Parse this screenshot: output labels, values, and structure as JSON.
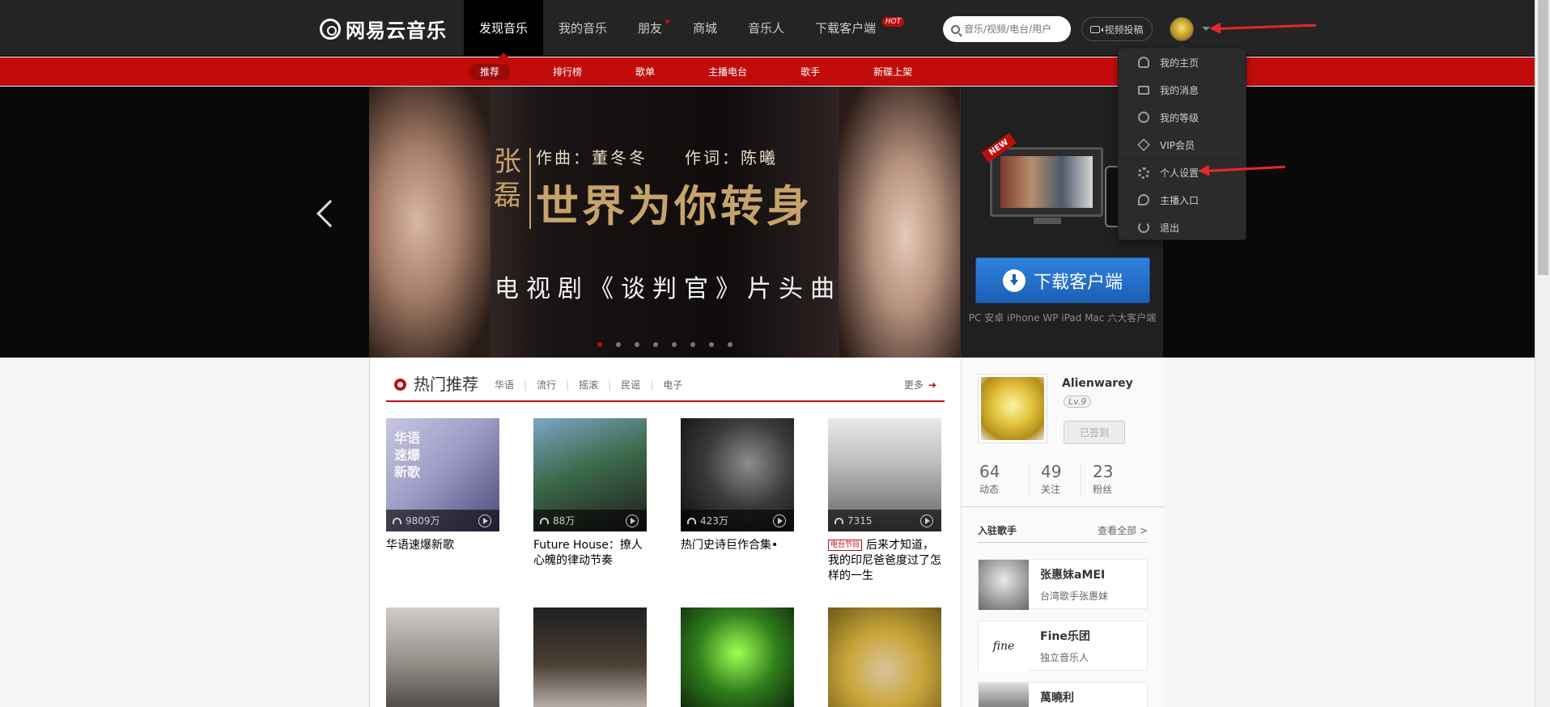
{
  "header": {
    "logo": "网易云音乐",
    "nav": [
      {
        "label": "发现音乐",
        "active": true
      },
      {
        "label": "我的音乐"
      },
      {
        "label": "朋友",
        "dot": true
      },
      {
        "label": "商城"
      },
      {
        "label": "音乐人"
      },
      {
        "label": "下载客户端",
        "badge": "HOT"
      }
    ],
    "search_placeholder": "音乐/视频/电台/用户",
    "upload_label": "视频投稿"
  },
  "subnav": [
    "推荐",
    "排行榜",
    "歌单",
    "主播电台",
    "歌手",
    "新碟上架"
  ],
  "banner": {
    "artist": "张磊",
    "credits": "作曲：董冬冬　　作词：陈曦",
    "song": "世界为你转身",
    "subtitle": "电视剧《谈判官》片头曲",
    "dots": 8,
    "active_dot": 0
  },
  "download": {
    "new_badge": "NEW",
    "button": "下载客户端",
    "note": "PC 安卓 iPhone WP iPad Mac 六大客户端"
  },
  "hot": {
    "title": "热门推荐",
    "tags": [
      "华语",
      "流行",
      "摇滚",
      "民谣",
      "电子"
    ],
    "more": "更多",
    "cards": [
      {
        "count": "9809万",
        "name": "华语速爆新歌",
        "cover_text": "华语\n速爆\n新歌"
      },
      {
        "count": "88万",
        "name": "Future House：撩人心魄的律动节奏"
      },
      {
        "count": "423万",
        "name": "热门史诗巨作合集•"
      },
      {
        "count": "7315",
        "name": "后来才知道，我的印尼爸爸度过了怎样的一生",
        "radio_tag": "电台节目"
      },
      {
        "count": "",
        "name": ""
      },
      {
        "count": "",
        "name": ""
      },
      {
        "count": "",
        "name": ""
      },
      {
        "count": "",
        "name": ""
      }
    ]
  },
  "profile": {
    "name": "Alienwarey",
    "level": "Lv.9",
    "signed": "已签到",
    "stats": [
      {
        "value": "64",
        "label": "动态"
      },
      {
        "value": "49",
        "label": "关注"
      },
      {
        "value": "23",
        "label": "粉丝"
      }
    ]
  },
  "artists": {
    "title": "入驻歌手",
    "view_all": "查看全部 >",
    "list": [
      {
        "name": "张惠妹aMEI",
        "desc": "台湾歌手张惠妹"
      },
      {
        "name": "Fine乐团",
        "desc": "独立音乐人",
        "logo_text": "fine"
      },
      {
        "name": "萬曉利",
        "desc": ""
      }
    ]
  },
  "dropdown": {
    "items": [
      {
        "label": "我的主页",
        "icon": "user-icon"
      },
      {
        "label": "我的消息",
        "icon": "mail-icon"
      },
      {
        "label": "我的等级",
        "icon": "level-icon"
      },
      {
        "label": "VIP会员",
        "icon": "diamond-icon"
      },
      {
        "label": "个人设置",
        "icon": "gear-icon"
      },
      {
        "label": "主播入口",
        "icon": "mic-icon"
      },
      {
        "label": "退出",
        "icon": "power-icon"
      }
    ]
  }
}
